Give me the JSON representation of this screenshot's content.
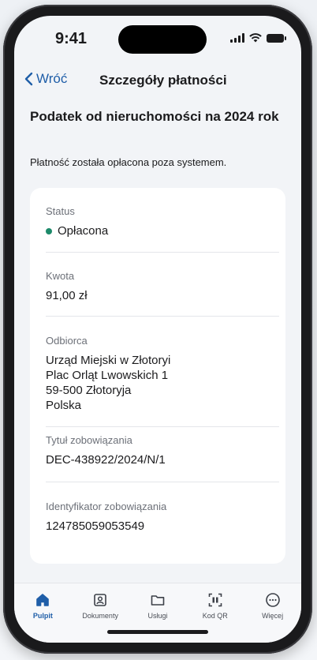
{
  "status_bar": {
    "time": "9:41"
  },
  "nav": {
    "back_label": "Wróć",
    "title": "Szczegóły płatności"
  },
  "heading": "Podatek od nieruchomości na 2024 rok",
  "info": "Płatność została opłacona poza systemem.",
  "card": {
    "status": {
      "label": "Status",
      "value": "Opłacona",
      "color": "#1d8a6a"
    },
    "amount": {
      "label": "Kwota",
      "value": "91,00 zł"
    },
    "recipient": {
      "label": "Odbiorca",
      "lines": [
        "Urząd Miejski w Złotoryi",
        "Plac Orląt Lwowskich 1",
        "59-500 Złotoryja",
        "Polska"
      ]
    },
    "title": {
      "label": "Tytuł zobowiązania",
      "value": "DEC-438922/2024/N/1"
    },
    "identifier": {
      "label": "Identyfikator zobowiązania",
      "value": "124785059053549"
    }
  },
  "tabs": [
    {
      "label": "Pulpit",
      "icon": "home-icon",
      "active": true
    },
    {
      "label": "Dokumenty",
      "icon": "documents-icon",
      "active": false
    },
    {
      "label": "Usługi",
      "icon": "folder-icon",
      "active": false
    },
    {
      "label": "Kod QR",
      "icon": "qr-code-icon",
      "active": false
    },
    {
      "label": "Więcej",
      "icon": "more-icon",
      "active": false
    }
  ],
  "colors": {
    "accent": "#1f5ea8",
    "text": "#1b1b1d",
    "muted": "#6c7078"
  }
}
